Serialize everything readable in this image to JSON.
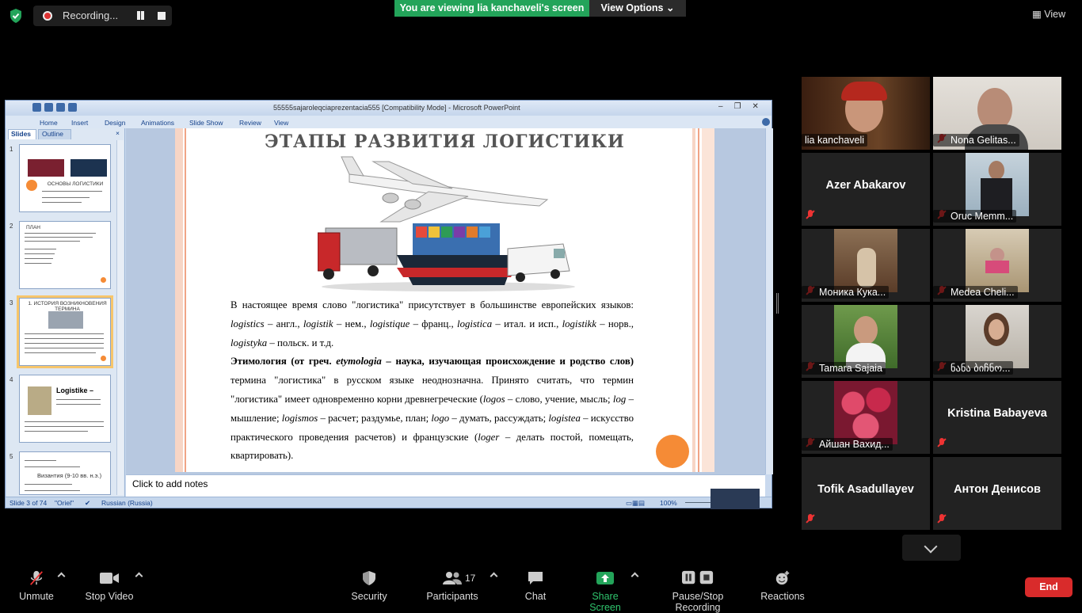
{
  "topbar": {
    "recording_label": "Recording...",
    "viewing_banner": "You are viewing lia kanchaveli's screen",
    "view_options_label": "View Options",
    "view_label": "View",
    "colors": {
      "viewing_green": "#23a45a",
      "recording_red": "#d33333"
    }
  },
  "ppt": {
    "title": "55555sajaroleqciaprezentacia555 [Compatibility Mode] - Microsoft PowerPoint",
    "ribbon_tabs": [
      "Home",
      "Insert",
      "Design",
      "Animations",
      "Slide Show",
      "Review",
      "View"
    ],
    "pane_tabs": {
      "slides": "Slides",
      "outline": "Outline"
    },
    "thumbnails": [
      {
        "num": "1",
        "caption": "ОСНОВЫ ЛОГИСТИКИ"
      },
      {
        "num": "2",
        "caption": "ПЛАН"
      },
      {
        "num": "3",
        "caption": "1. ИСТОРИЯ ВОЗНИКНОВЕНИЯ ТЕРМИНА"
      },
      {
        "num": "4",
        "caption": "Logistike –"
      },
      {
        "num": "5",
        "caption": "Византия (9-10 вв. н.э.)"
      }
    ],
    "slide": {
      "title": "ЭТАПЫ РАЗВИТИЯ ЛОГИСТИКИ",
      "p1_a": "В настоящее время слово \"логистика\" присутствует в большинстве европейских языков: ",
      "p1_w1": "logistics",
      "p1_t1": " – англ., ",
      "p1_w2": "logistik",
      "p1_t2": " – нем., ",
      "p1_w3": "logistique",
      "p1_t3": " – франц., ",
      "p1_w4": "logistica",
      "p1_t4": " – итал. и исп., ",
      "p1_w5": "logistikk",
      "p1_t5": " – норв., ",
      "p1_w6": "logistyka",
      "p1_t6": " – польск. и т.д.",
      "p2_bold_a": "Этимология (от греч. ",
      "p2_bold_i": "etymologia",
      "p2_bold_b": " – наука, изучающая происхождение и родство слов)",
      "p2_a": " термина \"логистика\" в русском языке неоднозначна. Принято считать, что термин \"логистика\" имеет одновременно корни древнегреческие (",
      "p2_w1": "logos",
      "p2_t1": " – слово, учение, мысль; ",
      "p2_w2": "log",
      "p2_t2": " – мышление; ",
      "p2_w3": "logismos",
      "p2_t3": " – расчет; раздумье, план; ",
      "p2_w4": "logo",
      "p2_t4": " – думать, рассуждать; ",
      "p2_w5": "logistea",
      "p2_t5": " – искусство практического проведения расчетов) и французские (",
      "p2_w6": "loger",
      "p2_t6": " – делать постой, помещать, квартировать)."
    },
    "notes_placeholder": "Click to add notes",
    "status": {
      "slide_of": "Slide 3 of 74",
      "theme": "\"Oriel\"",
      "language": "Russian (Russia)",
      "zoom": "100%"
    }
  },
  "participants": [
    {
      "name": "lia kanchaveli",
      "muted": false,
      "active": true,
      "video": true
    },
    {
      "name": "Nona Gelitas...",
      "muted": true,
      "active": false,
      "video": true
    },
    {
      "name": "Azer Abakarov",
      "muted": true,
      "active": false,
      "video": false
    },
    {
      "name": "Oruc Memm...",
      "muted": true,
      "active": false,
      "video": true
    },
    {
      "name": "Моника Кука...",
      "muted": true,
      "active": false,
      "video": true
    },
    {
      "name": "Medea Cheli...",
      "muted": true,
      "active": false,
      "video": true
    },
    {
      "name": "Tamara Sajaia",
      "muted": true,
      "active": false,
      "video": true
    },
    {
      "name": "ნანა ბიჩნო...",
      "muted": true,
      "active": false,
      "video": true
    },
    {
      "name": "Айшан Вахид...",
      "muted": true,
      "active": false,
      "video": true
    },
    {
      "name": "Kristina Babayeva",
      "muted": true,
      "active": false,
      "video": false
    },
    {
      "name": "Tofik Asadullayev",
      "muted": true,
      "active": false,
      "video": false
    },
    {
      "name": "Антон Денисов",
      "muted": true,
      "active": false,
      "video": false
    }
  ],
  "toolbar": {
    "unmute": "Unmute",
    "stop_video": "Stop Video",
    "security": "Security",
    "participants": "Participants",
    "participants_count": "17",
    "chat": "Chat",
    "share_screen": "Share Screen",
    "pause_stop_recording": "Pause/Stop Recording",
    "reactions": "Reactions",
    "end": "End",
    "colors": {
      "share_green": "#23a45a",
      "end_red": "#d92b2b"
    }
  }
}
